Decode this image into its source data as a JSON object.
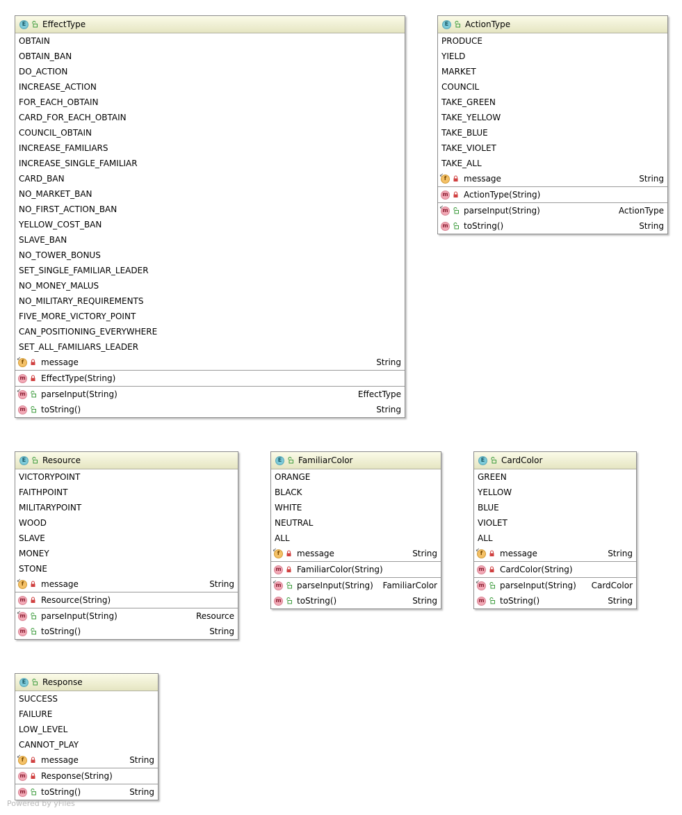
{
  "footer": "Powered by yFiles",
  "colors": {
    "header_top": "#fbfbe8",
    "header_bottom": "#e5e5c2",
    "enum_icon": "#7cc9d8",
    "field_icon": "#f4c168",
    "method_icon": "#f2a9b6",
    "public_lock": "#3a9a3a",
    "private_lock": "#d04040"
  },
  "classes": [
    {
      "id": "effecttype",
      "name": "EffectType",
      "constants": [
        "OBTAIN",
        "OBTAIN_BAN",
        "DO_ACTION",
        "INCREASE_ACTION",
        "FOR_EACH_OBTAIN",
        "CARD_FOR_EACH_OBTAIN",
        "COUNCIL_OBTAIN",
        "INCREASE_FAMILIARS",
        "INCREASE_SINGLE_FAMILIAR",
        "CARD_BAN",
        "NO_MARKET_BAN",
        "NO_FIRST_ACTION_BAN",
        "YELLOW_COST_BAN",
        "SLAVE_BAN",
        "NO_TOWER_BONUS",
        "SET_SINGLE_FAMILIAR_LEADER",
        "NO_MONEY_MALUS",
        "NO_MILITARY_REQUIREMENTS",
        "FIVE_MORE_VICTORY_POINT",
        "CAN_POSITIONING_EVERYWHERE",
        "SET_ALL_FAMILIARS_LEADER"
      ],
      "field": {
        "name": "message",
        "type": "String"
      },
      "constructor": "EffectType(String)",
      "methods": [
        {
          "name": "parseInput(String)",
          "type": "EffectType",
          "static": true
        },
        {
          "name": "toString()",
          "type": "String",
          "static": false
        }
      ]
    },
    {
      "id": "actiontype",
      "name": "ActionType",
      "constants": [
        "PRODUCE",
        "YIELD",
        "MARKET",
        "COUNCIL",
        "TAKE_GREEN",
        "TAKE_YELLOW",
        "TAKE_BLUE",
        "TAKE_VIOLET",
        "TAKE_ALL"
      ],
      "field": {
        "name": "message",
        "type": "String"
      },
      "constructor": "ActionType(String)",
      "methods": [
        {
          "name": "parseInput(String)",
          "type": "ActionType",
          "static": true
        },
        {
          "name": "toString()",
          "type": "String",
          "static": false
        }
      ]
    },
    {
      "id": "resource",
      "name": "Resource",
      "constants": [
        "VICTORYPOINT",
        "FAITHPOINT",
        "MILITARYPOINT",
        "WOOD",
        "SLAVE",
        "MONEY",
        "STONE"
      ],
      "field": {
        "name": "message",
        "type": "String"
      },
      "constructor": "Resource(String)",
      "methods": [
        {
          "name": "parseInput(String)",
          "type": "Resource",
          "static": true
        },
        {
          "name": "toString()",
          "type": "String",
          "static": false
        }
      ]
    },
    {
      "id": "familiarcolor",
      "name": "FamiliarColor",
      "constants": [
        "ORANGE",
        "BLACK",
        "WHITE",
        "NEUTRAL",
        "ALL"
      ],
      "field": {
        "name": "message",
        "type": "String"
      },
      "constructor": "FamiliarColor(String)",
      "methods": [
        {
          "name": "parseInput(String)",
          "type": "FamiliarColor",
          "static": true
        },
        {
          "name": "toString()",
          "type": "String",
          "static": false
        }
      ]
    },
    {
      "id": "cardcolor",
      "name": "CardColor",
      "constants": [
        "GREEN",
        "YELLOW",
        "BLUE",
        "VIOLET",
        "ALL"
      ],
      "field": {
        "name": "message",
        "type": "String"
      },
      "constructor": "CardColor(String)",
      "methods": [
        {
          "name": "parseInput(String)",
          "type": "CardColor",
          "static": true
        },
        {
          "name": "toString()",
          "type": "String",
          "static": false
        }
      ]
    },
    {
      "id": "response",
      "name": "Response",
      "constants": [
        "SUCCESS",
        "FAILURE",
        "LOW_LEVEL",
        "CANNOT_PLAY"
      ],
      "field": {
        "name": "message",
        "type": "String"
      },
      "constructor": "Response(String)",
      "methods": [
        {
          "name": "toString()",
          "type": "String",
          "static": false
        }
      ]
    }
  ]
}
